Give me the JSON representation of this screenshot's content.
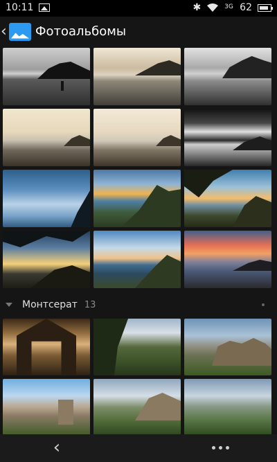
{
  "status_bar": {
    "time": "10:11",
    "network": "3G",
    "battery": "62"
  },
  "app_bar": {
    "title": "Фотоальбомы"
  },
  "albums": [
    {
      "name": "",
      "photos": [
        "bw-beach-silhouettes",
        "sepia-beach-figure",
        "bw-beach-dog-walk",
        "sepia-shore-waves",
        "sepia-shore-headland",
        "bw-dramatic-sky-sea",
        "blue-sky-contrails",
        "sunset-coast-cliffs",
        "pine-sunset-coast",
        "tree-silhouette-sunset",
        "blue-sky-sea-cliffs",
        "red-clouds-beach"
      ]
    },
    {
      "name": "Монтсерат",
      "count": "13",
      "photos": [
        "basilica-interior",
        "garden-trees-terrace",
        "rock-cliffs-vista",
        "monastery-mountain",
        "clouds-over-peaks",
        "valley-panorama"
      ]
    }
  ],
  "nav_bar": {
    "back_icon": "back-arrow",
    "more_icon": "more-dots"
  },
  "colors": {
    "background": "#151515",
    "status_bar": "#000000",
    "nav_bar": "#1b1b1b",
    "accent": "#2b9af0"
  }
}
